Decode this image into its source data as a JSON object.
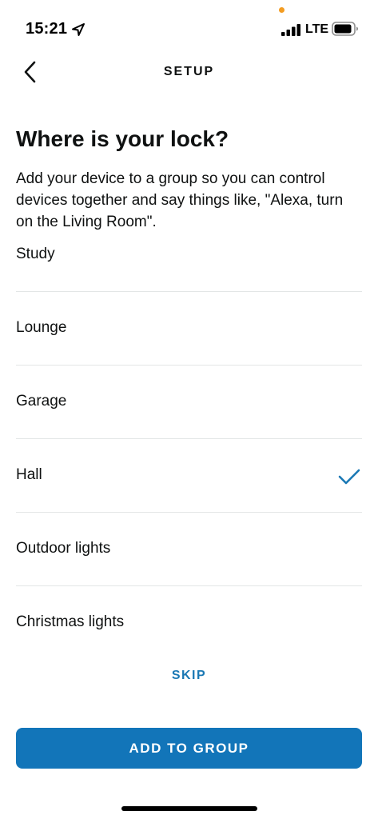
{
  "status_bar": {
    "time": "15:21",
    "network": "LTE",
    "icons": [
      "location-arrow-icon",
      "signal-bars-icon",
      "battery-icon"
    ],
    "dot_color": "#f39c21"
  },
  "header": {
    "title": "SETUP",
    "back_icon": "chevron-left-icon"
  },
  "main": {
    "title": "Where is your lock?",
    "description": "Add your device to a group so you can control devices together and say things like, \"Alexa, turn on the Living Room\".",
    "rooms": [
      {
        "label": "Study",
        "selected": false
      },
      {
        "label": "Lounge",
        "selected": false
      },
      {
        "label": "Garage",
        "selected": false
      },
      {
        "label": "Hall",
        "selected": true
      },
      {
        "label": "Outdoor lights",
        "selected": false
      },
      {
        "label": "Christmas lights",
        "selected": false
      }
    ],
    "skip_label": "SKIP",
    "primary_label": "ADD TO GROUP"
  },
  "colors": {
    "accent": "#1a78b4",
    "primary_button": "#1275b9",
    "divider": "#e3e6e6",
    "text": "#0f1111"
  }
}
